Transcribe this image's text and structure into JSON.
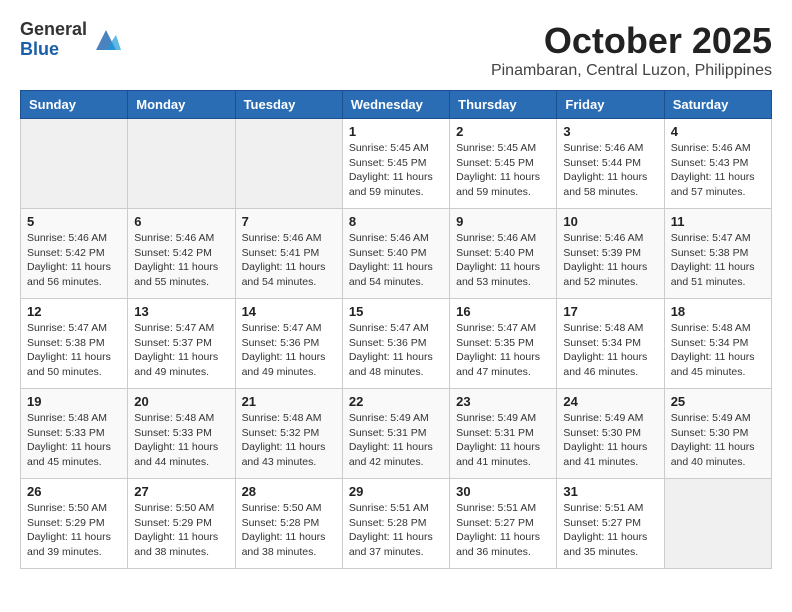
{
  "logo": {
    "general": "General",
    "blue": "Blue"
  },
  "header": {
    "month": "October 2025",
    "location": "Pinambaran, Central Luzon, Philippines"
  },
  "weekdays": [
    "Sunday",
    "Monday",
    "Tuesday",
    "Wednesday",
    "Thursday",
    "Friday",
    "Saturday"
  ],
  "weeks": [
    [
      {
        "day": "",
        "info": ""
      },
      {
        "day": "",
        "info": ""
      },
      {
        "day": "",
        "info": ""
      },
      {
        "day": "1",
        "info": "Sunrise: 5:45 AM\nSunset: 5:45 PM\nDaylight: 11 hours\nand 59 minutes."
      },
      {
        "day": "2",
        "info": "Sunrise: 5:45 AM\nSunset: 5:45 PM\nDaylight: 11 hours\nand 59 minutes."
      },
      {
        "day": "3",
        "info": "Sunrise: 5:46 AM\nSunset: 5:44 PM\nDaylight: 11 hours\nand 58 minutes."
      },
      {
        "day": "4",
        "info": "Sunrise: 5:46 AM\nSunset: 5:43 PM\nDaylight: 11 hours\nand 57 minutes."
      }
    ],
    [
      {
        "day": "5",
        "info": "Sunrise: 5:46 AM\nSunset: 5:42 PM\nDaylight: 11 hours\nand 56 minutes."
      },
      {
        "day": "6",
        "info": "Sunrise: 5:46 AM\nSunset: 5:42 PM\nDaylight: 11 hours\nand 55 minutes."
      },
      {
        "day": "7",
        "info": "Sunrise: 5:46 AM\nSunset: 5:41 PM\nDaylight: 11 hours\nand 54 minutes."
      },
      {
        "day": "8",
        "info": "Sunrise: 5:46 AM\nSunset: 5:40 PM\nDaylight: 11 hours\nand 54 minutes."
      },
      {
        "day": "9",
        "info": "Sunrise: 5:46 AM\nSunset: 5:40 PM\nDaylight: 11 hours\nand 53 minutes."
      },
      {
        "day": "10",
        "info": "Sunrise: 5:46 AM\nSunset: 5:39 PM\nDaylight: 11 hours\nand 52 minutes."
      },
      {
        "day": "11",
        "info": "Sunrise: 5:47 AM\nSunset: 5:38 PM\nDaylight: 11 hours\nand 51 minutes."
      }
    ],
    [
      {
        "day": "12",
        "info": "Sunrise: 5:47 AM\nSunset: 5:38 PM\nDaylight: 11 hours\nand 50 minutes."
      },
      {
        "day": "13",
        "info": "Sunrise: 5:47 AM\nSunset: 5:37 PM\nDaylight: 11 hours\nand 49 minutes."
      },
      {
        "day": "14",
        "info": "Sunrise: 5:47 AM\nSunset: 5:36 PM\nDaylight: 11 hours\nand 49 minutes."
      },
      {
        "day": "15",
        "info": "Sunrise: 5:47 AM\nSunset: 5:36 PM\nDaylight: 11 hours\nand 48 minutes."
      },
      {
        "day": "16",
        "info": "Sunrise: 5:47 AM\nSunset: 5:35 PM\nDaylight: 11 hours\nand 47 minutes."
      },
      {
        "day": "17",
        "info": "Sunrise: 5:48 AM\nSunset: 5:34 PM\nDaylight: 11 hours\nand 46 minutes."
      },
      {
        "day": "18",
        "info": "Sunrise: 5:48 AM\nSunset: 5:34 PM\nDaylight: 11 hours\nand 45 minutes."
      }
    ],
    [
      {
        "day": "19",
        "info": "Sunrise: 5:48 AM\nSunset: 5:33 PM\nDaylight: 11 hours\nand 45 minutes."
      },
      {
        "day": "20",
        "info": "Sunrise: 5:48 AM\nSunset: 5:33 PM\nDaylight: 11 hours\nand 44 minutes."
      },
      {
        "day": "21",
        "info": "Sunrise: 5:48 AM\nSunset: 5:32 PM\nDaylight: 11 hours\nand 43 minutes."
      },
      {
        "day": "22",
        "info": "Sunrise: 5:49 AM\nSunset: 5:31 PM\nDaylight: 11 hours\nand 42 minutes."
      },
      {
        "day": "23",
        "info": "Sunrise: 5:49 AM\nSunset: 5:31 PM\nDaylight: 11 hours\nand 41 minutes."
      },
      {
        "day": "24",
        "info": "Sunrise: 5:49 AM\nSunset: 5:30 PM\nDaylight: 11 hours\nand 41 minutes."
      },
      {
        "day": "25",
        "info": "Sunrise: 5:49 AM\nSunset: 5:30 PM\nDaylight: 11 hours\nand 40 minutes."
      }
    ],
    [
      {
        "day": "26",
        "info": "Sunrise: 5:50 AM\nSunset: 5:29 PM\nDaylight: 11 hours\nand 39 minutes."
      },
      {
        "day": "27",
        "info": "Sunrise: 5:50 AM\nSunset: 5:29 PM\nDaylight: 11 hours\nand 38 minutes."
      },
      {
        "day": "28",
        "info": "Sunrise: 5:50 AM\nSunset: 5:28 PM\nDaylight: 11 hours\nand 38 minutes."
      },
      {
        "day": "29",
        "info": "Sunrise: 5:51 AM\nSunset: 5:28 PM\nDaylight: 11 hours\nand 37 minutes."
      },
      {
        "day": "30",
        "info": "Sunrise: 5:51 AM\nSunset: 5:27 PM\nDaylight: 11 hours\nand 36 minutes."
      },
      {
        "day": "31",
        "info": "Sunrise: 5:51 AM\nSunset: 5:27 PM\nDaylight: 11 hours\nand 35 minutes."
      },
      {
        "day": "",
        "info": ""
      }
    ]
  ]
}
